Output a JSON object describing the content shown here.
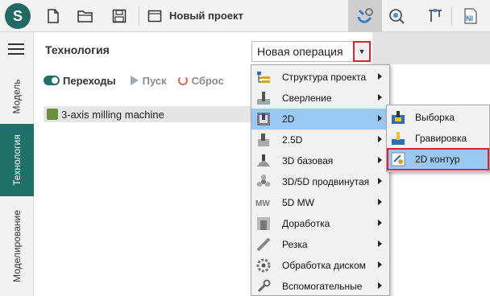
{
  "toolbar": {
    "project_title": "Новый проект",
    "logo_letter": "S"
  },
  "rail": {
    "tabs": [
      {
        "label": "Модель"
      },
      {
        "label": "Технология"
      },
      {
        "label": "Моделирование"
      }
    ],
    "active_tab": "Технология"
  },
  "panel": {
    "title": "Технология",
    "new_operation_label": "Новая операция",
    "controls": {
      "transitions_label": "Переходы",
      "start_label": "Пуск",
      "reset_label": "Сброс"
    },
    "tree": [
      {
        "label": "3-axis milling machine"
      }
    ]
  },
  "menu": {
    "items": [
      {
        "label": "Структура проекта",
        "icon": "project-structure-icon",
        "has_submenu": true
      },
      {
        "label": "Сверление",
        "icon": "drilling-icon",
        "has_submenu": true
      },
      {
        "label": "2D",
        "icon": "2d-icon",
        "has_submenu": true,
        "highlighted": true
      },
      {
        "label": "2.5D",
        "icon": "2-5d-icon",
        "has_submenu": true
      },
      {
        "label": "3D базовая",
        "icon": "3d-basic-icon",
        "has_submenu": true
      },
      {
        "label": "3D/5D продвинутая",
        "icon": "3d-5d-advanced-icon",
        "has_submenu": true
      },
      {
        "label": "5D MW",
        "icon": "5d-mw-icon",
        "has_submenu": true
      },
      {
        "label": "Доработка",
        "icon": "rework-icon",
        "has_submenu": true
      },
      {
        "label": "Резка",
        "icon": "cutting-icon",
        "has_submenu": true
      },
      {
        "label": "Обработка диском",
        "icon": "disk-machining-icon",
        "has_submenu": true
      },
      {
        "label": "Вспомогательные",
        "icon": "auxiliary-icon",
        "has_submenu": true
      }
    ]
  },
  "submenu": {
    "items": [
      {
        "label": "Выборка",
        "icon": "pocketing-icon"
      },
      {
        "label": "Гравировка",
        "icon": "engraving-icon"
      },
      {
        "label": "2D контур",
        "icon": "2d-contour-icon",
        "highlighted": true
      }
    ]
  },
  "colors": {
    "accent_teal": "#1f7168",
    "highlight_blue": "#99c9f3",
    "callout_red": "#e0202a"
  }
}
